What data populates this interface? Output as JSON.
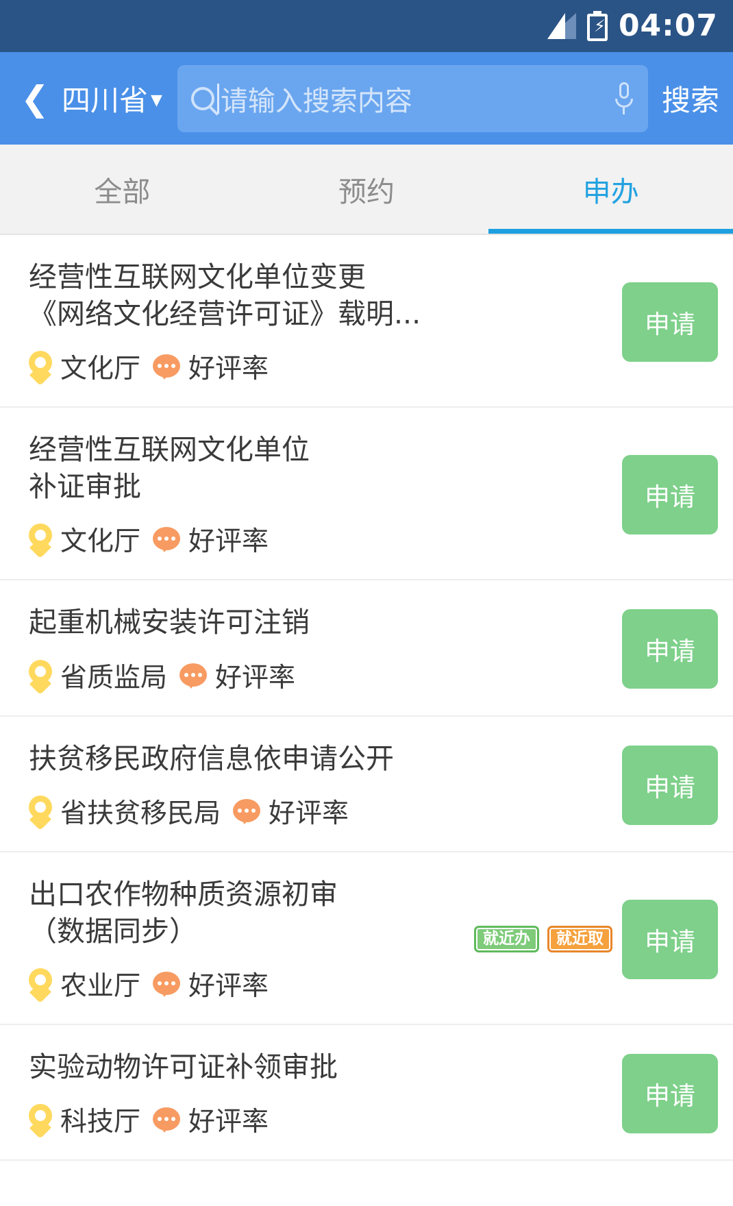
{
  "status_bar": {
    "time": "04:07",
    "signal_icon": "signal-bars-icon",
    "battery_icon": "battery-charging-icon",
    "background": "#2b5486"
  },
  "header": {
    "back_icon": "chevron-left-icon",
    "region": "四川省",
    "region_caret": "▼",
    "search": {
      "icon": "search-icon",
      "placeholder": "请输入搜索内容",
      "value": "",
      "mic_icon": "microphone-icon"
    },
    "search_button": "搜索",
    "background": "#4a90e8"
  },
  "tabs": {
    "items": [
      {
        "label": "全部",
        "active": false
      },
      {
        "label": "预约",
        "active": false
      },
      {
        "label": "申办",
        "active": true
      }
    ],
    "active_color": "#22a2e0",
    "inactive_color": "#8c8c8c"
  },
  "list": {
    "apply_label": "申请",
    "rating_label": "好评率",
    "items": [
      {
        "title": "经营性互联网文化单位变更\n《网络文化经营许可证》载明...",
        "department": "文化厅",
        "rating": "好评率",
        "badges": [],
        "action": "申请"
      },
      {
        "title": "经营性互联网文化单位\n补证审批",
        "department": "文化厅",
        "rating": "好评率",
        "badges": [],
        "action": "申请"
      },
      {
        "title": "起重机械安装许可注销",
        "department": "省质监局",
        "rating": "好评率",
        "badges": [],
        "action": "申请"
      },
      {
        "title": "扶贫移民政府信息依申请公开",
        "department": "省扶贫移民局",
        "rating": "好评率",
        "badges": [],
        "action": "申请"
      },
      {
        "title": "出口农作物种质资源初审\n（数据同步）",
        "department": "农业厅",
        "rating": "好评率",
        "badges": [
          {
            "label": "就近办",
            "color": "green"
          },
          {
            "label": "就近取",
            "color": "orange"
          }
        ],
        "action": "申请"
      },
      {
        "title": "实验动物许可证补领审批",
        "department": "科技厅",
        "rating": "好评率",
        "badges": [],
        "action": "申请"
      }
    ]
  },
  "colors": {
    "header_blue": "#4a90e8",
    "status_blue": "#2b5486",
    "tab_active": "#1e9fe0",
    "apply_green": "#7ed08a",
    "pin_yellow": "#ffd95e",
    "bubble_orange": "#f79b62",
    "badge_green": "#7ecb7a",
    "badge_orange": "#f5a13d"
  }
}
